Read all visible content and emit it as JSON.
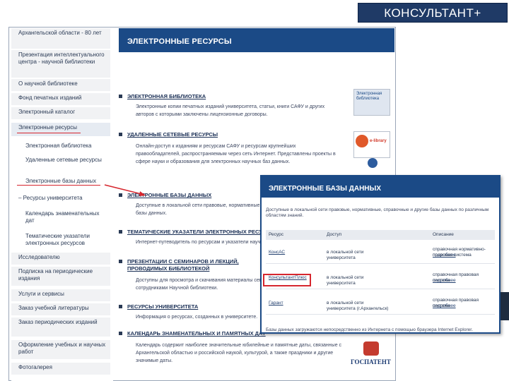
{
  "brand": "КОНСУЛЬТАНТ+",
  "sidebar": {
    "items": [
      {
        "label": "Архангельской области - 80 лет",
        "sub": false
      },
      {
        "label": "Презентация интеллектуального центра - научной библиотеки",
        "sub": false
      },
      {
        "label": "О научной библиотеке",
        "sub": false
      },
      {
        "label": "Фонд печатных изданий",
        "sub": false
      },
      {
        "label": "Электронный каталог",
        "sub": false
      },
      {
        "label": "Электронные ресурсы",
        "sub": false,
        "hl": true
      },
      {
        "label": "Электронная библиотека",
        "sub": true
      },
      {
        "label": "Удаленные сетевые ресурсы",
        "sub": true
      },
      {
        "label": "Электронные базы данных",
        "sub": true
      },
      {
        "label": "– Ресурсы университета",
        "sub": false
      },
      {
        "label": "Календарь знаменательных дат",
        "sub": true
      },
      {
        "label": "Тематические указатели электронных ресурсов",
        "sub": true
      },
      {
        "label": "Исследователю",
        "sub": false
      },
      {
        "label": "Подписка на периодические издания",
        "sub": false
      },
      {
        "label": "Услуги и сервисы",
        "sub": false
      },
      {
        "label": "Заказ учебной литературы",
        "sub": false
      },
      {
        "label": "Заказ периодических изданий",
        "sub": false
      },
      {
        "label": "Оформление учебных и научных работ",
        "sub": false
      },
      {
        "label": "Фотогалерея",
        "sub": false
      }
    ]
  },
  "main": {
    "heading": "ЭЛЕКТРОННЫЕ РЕСУРСЫ",
    "sections": [
      {
        "title": "ЭЛЕКТРОННАЯ БИБЛИОТЕКА",
        "desc": "Электронные копии печатных изданий университета, статьи, книги САФУ и других авторов с которыми заключены лицензионные договоры."
      },
      {
        "title": "УДАЛЕННЫЕ СЕТЕВЫЕ РЕСУРСЫ",
        "desc": "Онлайн-доступ к изданиям и ресурсам САФУ и ресурсам крупнейших правообладателей, распространяемым через сеть Интернет. Представлены проекты в сфере науки и образования для электронных научных баз данных."
      },
      {
        "title": "ЭЛЕКТРОННЫЕ БАЗЫ ДАННЫХ",
        "desc": "Доступные в локальной сети правовые, нормативные, справочные и аналитические базы данных."
      },
      {
        "title": "ТЕМАТИЧЕСКИЕ УКАЗАТЕЛИ ЭЛЕКТРОННЫХ РЕСУРСОВ",
        "desc": "Интернет-путеводитель по ресурсам и указатели научных изданий."
      },
      {
        "title": "ПРЕЗЕНТАЦИИ С СЕМИНАРОВ И ЛЕКЦИЙ, ПРОВОДИМЫХ БИБЛИОТЕКОЙ",
        "desc": "Доступны для просмотра и скачивания материалы семинаров и лекций, проведённых сотрудниками Научной библиотеки."
      },
      {
        "title": "РЕСУРСЫ УНИВЕРСИТЕТА",
        "desc": "Информация о ресурсах, созданных в университете."
      },
      {
        "title": "КАЛЕНДАРЬ ЗНАМЕНАТЕЛЬНЫХ И ПАМЯТНЫХ ДАТ",
        "desc": "Календарь содержит наиболее значительные юбилейные и памятные даты, связанные с Архангельской областью и российской наукой, культурой, а также праздники и другие значимые даты."
      }
    ],
    "thumb1": "Электронная библиотека",
    "thumb2": "e-library",
    "thumb3": "ГОСПАТЕНТ"
  },
  "overlay": {
    "heading": "ЭЛЕКТРОННЫЕ БАЗЫ ДАННЫХ",
    "intro": "Доступные в локальной сети правовые, нормативные, справочные и другие базы данных по различным областям знаний.",
    "headers": {
      "resource": "Ресурс",
      "access": "Доступ",
      "description": "Описание"
    },
    "rows": [
      {
        "resource": "КонсАС",
        "access": "в локальной сети университета",
        "description": "справочная нормативно-правовая система",
        "link": "подробнее"
      },
      {
        "resource": "КонсультантПлюс",
        "access": "в локальной сети университета",
        "description": "справочная правовая система",
        "link": "подробнее"
      },
      {
        "resource": "Гарант",
        "access": "в локальной сети университета (г.Архангельск)",
        "description": "справочная правовая система",
        "link": "подробнее"
      }
    ],
    "footer": "Базы данных загружаются непосредственно из Интернета с помощью браузера Internet Explorer."
  }
}
